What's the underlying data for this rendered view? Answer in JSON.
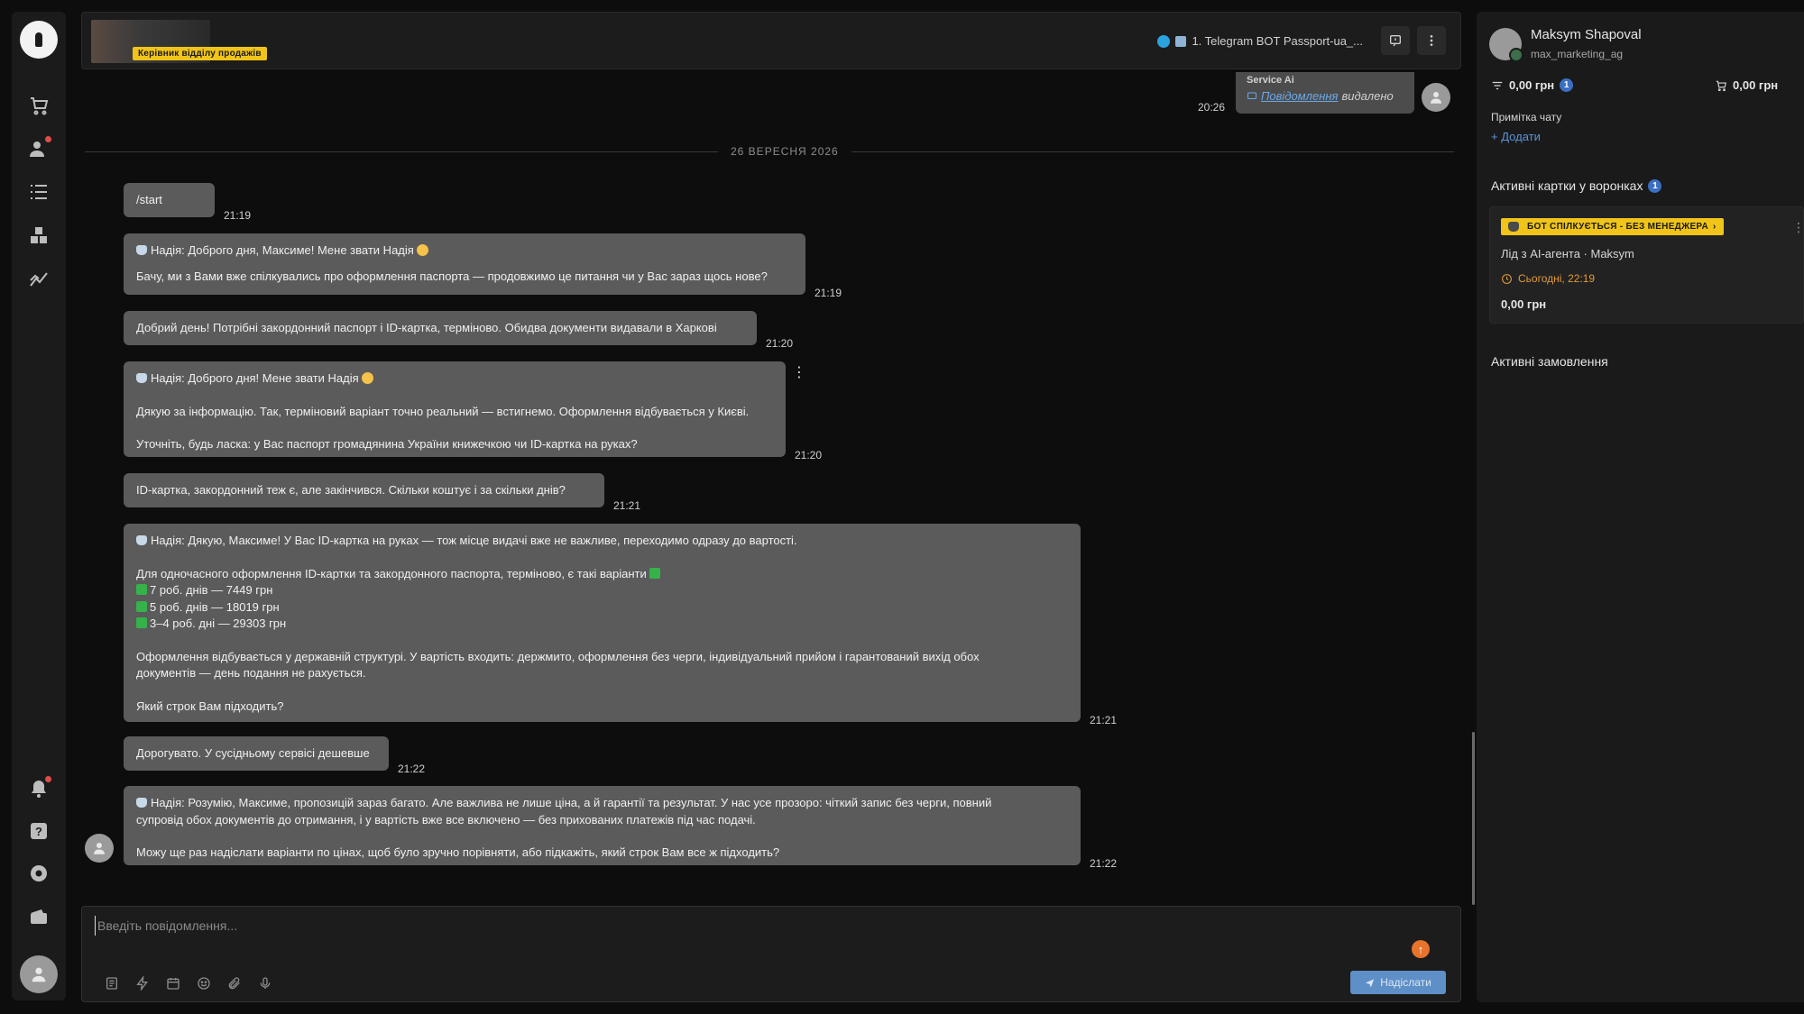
{
  "header": {
    "role_badge": "Керівник відділу продажів",
    "channel": "1. Telegram BOT Passport-ua_..."
  },
  "service_message": {
    "sender": "Service Ai",
    "time": "20:26",
    "link_text": "Повідомлення",
    "status_text": "видалено"
  },
  "date_divider": "26 ВЕРЕСНЯ 2026",
  "messages": [
    {
      "text": "/start",
      "time": "21:19"
    },
    {
      "line1": "Надія: Доброго дня, Максиме! Мене звати Надія",
      "line2": "Бачу, ми з Вами вже спілкувались про оформлення паспорта — продовжимо це питання чи у Вас зараз щось нове?",
      "time": "21:19"
    },
    {
      "text": "Добрий день! Потрібні закордонний паспорт і ID-картка, терміново. Обидва документи видавали в Харкові",
      "time": "21:20"
    },
    {
      "line1": "Надія: Доброго дня! Мене звати Надія",
      "line2": "Дякую за інформацію. Так, терміновий варіант точно реальний — встигнемо. Оформлення відбувається у Києві.",
      "line3": "Уточніть, будь ласка: у Вас паспорт громадянина України книжечкою чи ID-картка на руках?",
      "time": "21:20"
    },
    {
      "text": "ID-картка, закордонний теж є, але закінчився. Скільки коштує і за скільки днів?",
      "time": "21:21"
    },
    {
      "line1": "Надія: Дякую, Максиме! У Вас ID-картка на руках — тож місце видачі вже не важливе, переходимо одразу до вартості.",
      "line2": "Для одночасного оформлення ID-картки та закордонного паспорта, терміново, є такі варіанти",
      "opt1": "7 роб. днів — 7449 грн",
      "opt2": "5 роб. днів — 18019 грн",
      "opt3": "3–4 роб. дні — 29303 грн",
      "line3": "Оформлення відбувається у державній структурі. У вартість входить: держмито, оформлення без черги, індивідуальний прийом і гарантований вихід обох",
      "line4": "документів — день подання не рахується.",
      "line5": "Який строк Вам підходить?",
      "time": "21:21"
    },
    {
      "text": "Дорогувато. У сусідньому сервісі дешевше",
      "time": "21:22"
    },
    {
      "line1": "Надія: Розумію, Максиме, пропозицій зараз багато. Але важлива не лише ціна, а й гарантії та результат. У нас усе прозоро: чіткий запис без черги, повний",
      "line2": "супровід обох документів до отримання, і у вартість вже все включено — без прихованих платежів під час подачі.",
      "line3": "Можу ще раз надіслати варіанти по цінах, щоб було зручно порівняти, або підкажіть, який строк Вам все ж підходить?",
      "time": "21:22"
    }
  ],
  "composer": {
    "placeholder": "Введіть повідомлення...",
    "send_label": "Надіслати"
  },
  "contact": {
    "name": "Maksym Shapoval",
    "handle": "max_marketing_ag",
    "balance": "0,00 грн",
    "balance_count": "1",
    "cart": "0,00 грн",
    "note_label": "Примітка чату",
    "add_label": "Додати",
    "funnels_title": "Активні картки у воронках",
    "funnels_count": "1",
    "card": {
      "tag": "БОТ СПІЛКУЄТЬСЯ - БЕЗ МЕНЕДЖЕРА",
      "title": "Лід з AI-агента · Maksym",
      "date": "Сьогодні, 22:19",
      "sum": "0,00 грн"
    },
    "orders_title": "Активні замовлення"
  },
  "colors": {
    "accent_yellow": "#f0c419",
    "link_blue": "#5b93d9",
    "bubble": "#5b5b5b",
    "send_button": "#5f8fc7"
  }
}
